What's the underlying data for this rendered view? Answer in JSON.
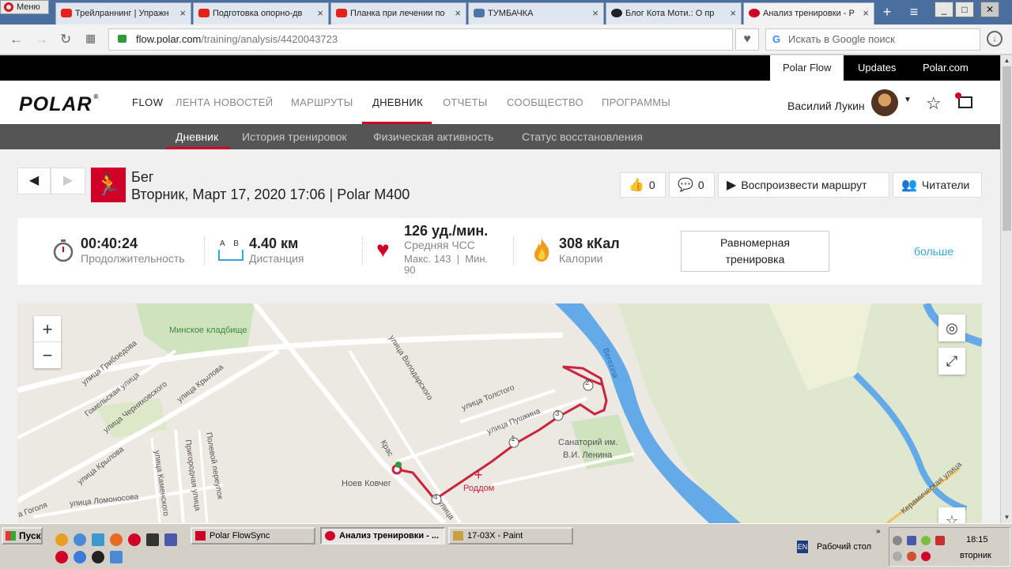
{
  "browser": {
    "menu_label": "Меню",
    "tabs": [
      {
        "title": "Трейлраннинг | Упражн",
        "favicon": "youtube-icon"
      },
      {
        "title": "Подготовка опорно-дв",
        "favicon": "youtube-icon"
      },
      {
        "title": "Планка при лечении по",
        "favicon": "youtube-icon"
      },
      {
        "title": "ТУМБАЧКА",
        "favicon": "vk-icon"
      },
      {
        "title": "Блог Кота Моти.: О пр",
        "favicon": "cat-icon"
      },
      {
        "title": "Анализ тренировки - Р",
        "favicon": "polar-icon"
      }
    ],
    "url_host": "flow.polar.com",
    "url_path": "/training/analysis/4420043723",
    "search_placeholder": "Искать в Google поиск",
    "google_mark": "G"
  },
  "top_links": {
    "polar_flow": "Polar Flow",
    "updates": "Updates",
    "polar_com": "Polar.com"
  },
  "header": {
    "logo_text": "POLAR",
    "logo_mark": "®",
    "flow_label": "FLOW",
    "nav": [
      {
        "label": "ЛЕНТА НОВОСТЕЙ"
      },
      {
        "label": "МАРШРУТЫ"
      },
      {
        "label": "ДНЕВНИК"
      },
      {
        "label": "ОТЧЕТЫ"
      },
      {
        "label": "СООБЩЕСТВО"
      },
      {
        "label": "ПРОГРАММЫ"
      }
    ],
    "user_name": "Василий Лукин"
  },
  "subnav": [
    {
      "label": "Дневник"
    },
    {
      "label": "История тренировок"
    },
    {
      "label": "Физическая активность"
    },
    {
      "label": "Статус восстановления"
    }
  ],
  "session": {
    "sport": "Бег",
    "date_device": "Вторник, Март 17, 2020 17:06 | Polar M400"
  },
  "actions": {
    "likes": "0",
    "comments": "0",
    "replay": "Воспроизвести маршрут",
    "followers": "Читатели"
  },
  "stats": {
    "duration_value": "00:40:24",
    "duration_label": "Продолжительность",
    "distance_ab": "A    B",
    "distance_value": "4.40 км",
    "distance_label": "Дистанция",
    "hr_value": "126 уд./мин.",
    "hr_label": "Средняя ЧСС",
    "hr_range": "Макс. 143  |  Мин.",
    "hr_min": "90",
    "calories_value": "308 кКал",
    "calories_label": "Калории",
    "type_line1": "Равномерная",
    "type_line2": "тренировка",
    "more": "больше"
  },
  "map": {
    "labels": {
      "cemetery": "Минское кладбище",
      "griboedova": "улица Грибоедова",
      "gomelskaya": "Гомельская улица",
      "chernyakhovsky": "улица Черняховского",
      "krylova1": "улица Крылова",
      "krylova2": "улица Крылова",
      "polevoy": "Полевой переулок",
      "prigorodnaya": "Пригородная улица",
      "kamenskogo": "улица Каменского",
      "lomonosova": "улица Ломоносова",
      "gogolya": "а Гоголя",
      "volodarskogo": "улица Володарского",
      "tolstogo": "улица Толстого",
      "pushkina": "улица Пушкина",
      "sanatorium1": "Санаторий им.",
      "sanatorium2": "В.И. Ленина",
      "noev": "Ноев Ковчег",
      "roddom": "Роддом",
      "berezina": "Berezina",
      "keramicheskaya": "Керамическая улица",
      "krasn": "Крас",
      "left_fragment": "кс",
      "marker_1": "1",
      "marker_2": "2",
      "marker_3": "3",
      "marker_4": "4",
      "ulitsa_frag": "улица"
    },
    "zoom_in": "+",
    "zoom_out": "−"
  },
  "taskbar": {
    "start": "Пуск",
    "items": [
      {
        "label": "Polar FlowSync"
      },
      {
        "label": "Анализ тренировки - ..."
      },
      {
        "label": "17-03X - Paint"
      }
    ],
    "lang": "EN",
    "desktop": "Рабочий стол",
    "time": "18:15",
    "weekday": "вторник"
  },
  "colors": {
    "polar_red": "#d10027",
    "link_blue": "#35a7d6",
    "route": "#c8243f",
    "river": "#64a9e8"
  }
}
